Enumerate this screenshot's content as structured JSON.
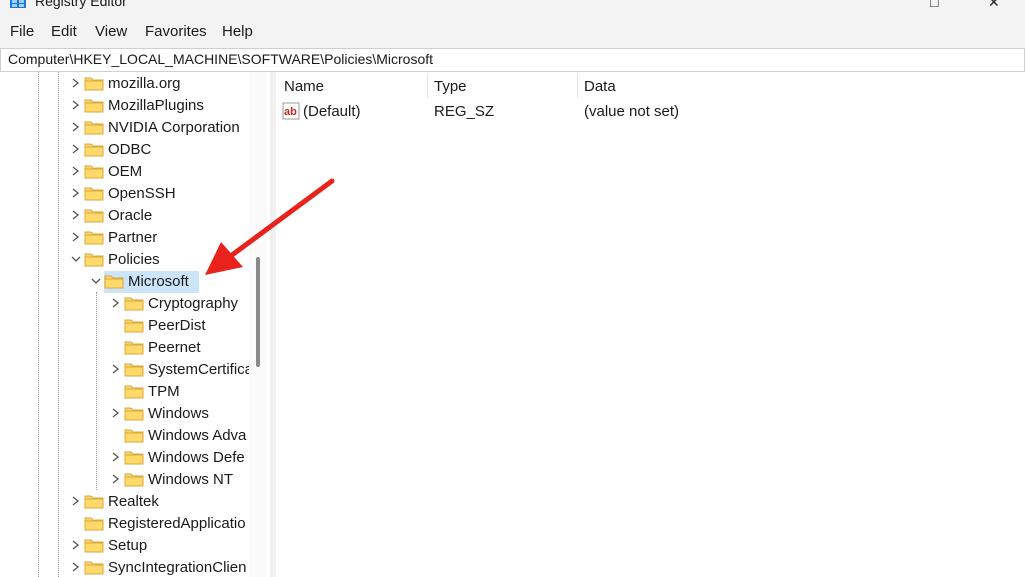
{
  "window": {
    "title": "Registry Editor"
  },
  "menu": [
    "File",
    "Edit",
    "View",
    "Favorites",
    "Help"
  ],
  "address": "Computer\\HKEY_LOCAL_MACHINE\\SOFTWARE\\Policies\\Microsoft",
  "tree": {
    "items": [
      {
        "label": "mozilla.org",
        "expander": "collapsed"
      },
      {
        "label": "MozillaPlugins",
        "expander": "collapsed"
      },
      {
        "label": "NVIDIA Corporation",
        "expander": "collapsed"
      },
      {
        "label": "ODBC",
        "expander": "collapsed"
      },
      {
        "label": "OEM",
        "expander": "collapsed"
      },
      {
        "label": "OpenSSH",
        "expander": "collapsed"
      },
      {
        "label": "Oracle",
        "expander": "collapsed"
      },
      {
        "label": "Partner",
        "expander": "collapsed"
      },
      {
        "label": "Policies",
        "expander": "expanded"
      },
      {
        "label": "Microsoft",
        "expander": "expanded",
        "selected": true
      },
      {
        "label": "Cryptography",
        "expander": "collapsed"
      },
      {
        "label": "PeerDist",
        "expander": "none"
      },
      {
        "label": "Peernet",
        "expander": "none"
      },
      {
        "label": "SystemCertifica",
        "expander": "collapsed"
      },
      {
        "label": "TPM",
        "expander": "none"
      },
      {
        "label": "Windows",
        "expander": "collapsed"
      },
      {
        "label": "Windows Adva",
        "expander": "none"
      },
      {
        "label": "Windows Defe",
        "expander": "collapsed"
      },
      {
        "label": "Windows NT",
        "expander": "collapsed"
      },
      {
        "label": "Realtek",
        "expander": "collapsed"
      },
      {
        "label": "RegisteredApplicatio",
        "expander": "none"
      },
      {
        "label": "Setup",
        "expander": "collapsed"
      },
      {
        "label": "SyncIntegrationClien",
        "expander": "collapsed"
      }
    ]
  },
  "values": {
    "columns": [
      "Name",
      "Type",
      "Data"
    ],
    "rows": [
      {
        "name": "(Default)",
        "type": "REG_SZ",
        "data": "(value not set)",
        "icon": "string-value-icon"
      }
    ]
  },
  "colors": {
    "selection": "#cce4f7",
    "folder": "#f8d775",
    "annotation_arrow": "#e8231b"
  }
}
